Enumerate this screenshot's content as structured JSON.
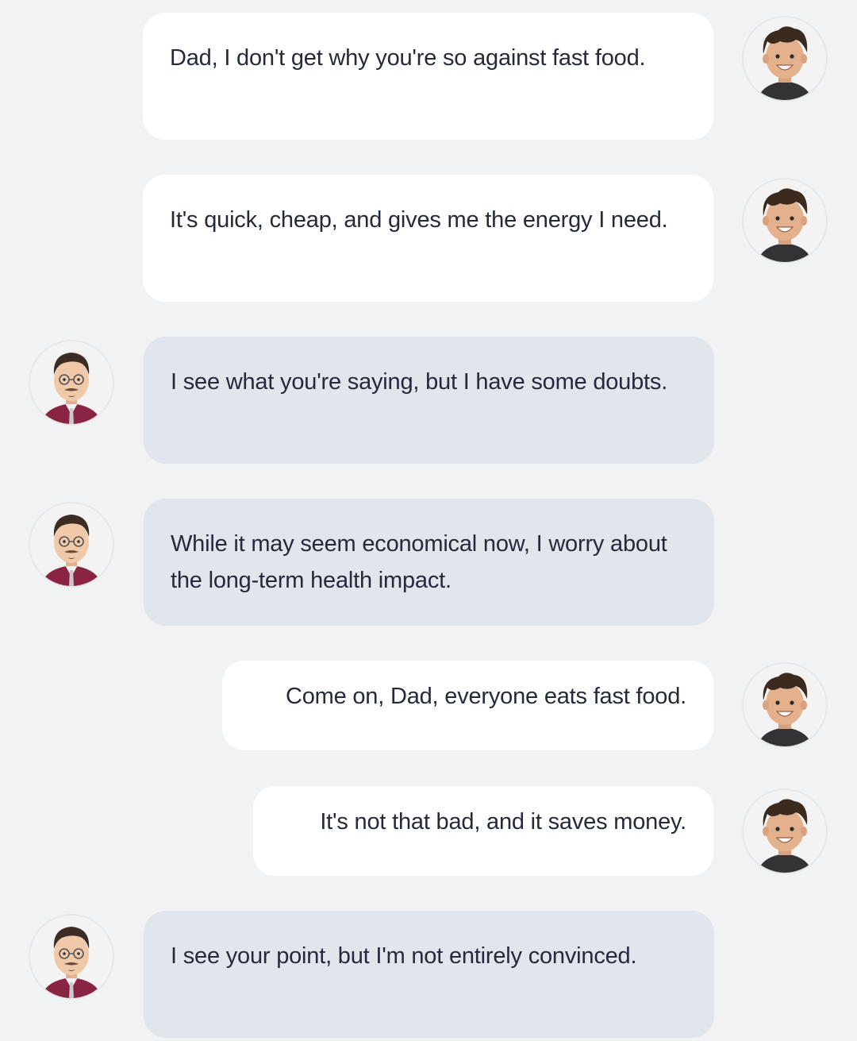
{
  "conversation": {
    "messages": [
      {
        "sender": "son",
        "text": "Dad, I don't get why you're so against fast food."
      },
      {
        "sender": "son",
        "text": "It's quick, cheap, and gives me the energy I need."
      },
      {
        "sender": "dad",
        "text": "I see what you're saying, but I have some doubts."
      },
      {
        "sender": "dad",
        "text": "While it may seem economical now, I worry about the long-term health impact."
      },
      {
        "sender": "son",
        "text": "Come on, Dad, everyone eats fast food."
      },
      {
        "sender": "son",
        "text": "It's not that bad, and it saves money."
      },
      {
        "sender": "dad",
        "text": "I see your point, but I'm not entirely convinced."
      }
    ]
  },
  "colors": {
    "background": "#f1f2f4",
    "son_bubble": "#ffffff",
    "dad_bubble": "#e1e5ec",
    "text": "#252a3a",
    "dad_shirt": "#8a2443",
    "son_hair": "#3b2a1e"
  }
}
